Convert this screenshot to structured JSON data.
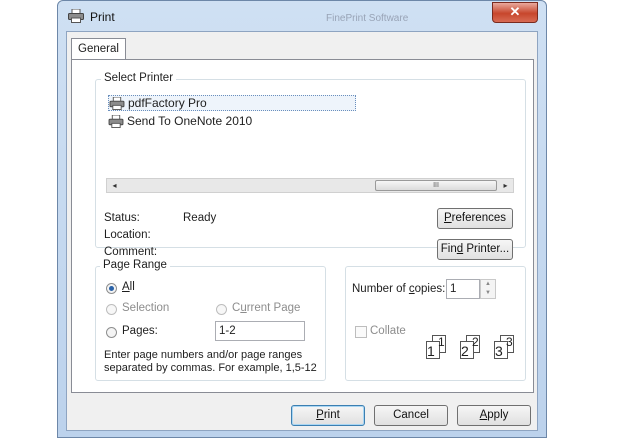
{
  "window": {
    "title": "Print",
    "background_title": "FinePrint Software",
    "close_symbol": "✕"
  },
  "tabs": [
    {
      "label": "General",
      "selected": true
    }
  ],
  "select_printer": {
    "legend": "Select Printer",
    "printers": [
      {
        "label": "pdfFactory Pro",
        "selected": true
      },
      {
        "label": "Send To OneNote 2010",
        "selected": false
      }
    ],
    "scroll_left": "◂",
    "scroll_right": "▸",
    "thumb_grip": "III",
    "status_label": "Status:",
    "status_value": "Ready",
    "location_label": "Location:",
    "comment_label": "Comment:",
    "preferences_button": {
      "pre": "",
      "key": "P",
      "post": "references"
    },
    "find_printer_button": {
      "pre": "Fin",
      "key": "d",
      "post": " Printer..."
    }
  },
  "page_range": {
    "legend": "Page Range",
    "all_label": {
      "pre": "",
      "key": "A",
      "post": "ll"
    },
    "selection_label": "Selection",
    "current_page_label": {
      "pre": "C",
      "key": "u",
      "post": "rrent Page"
    },
    "pages_label": {
      "pre": "Pa",
      "key": "g",
      "post": "es:"
    },
    "pages_value": "1-2",
    "hint_line1": "Enter page numbers and/or page ranges",
    "hint_line2": "separated by commas.  For example, 1,5-12",
    "selected": "all"
  },
  "copies": {
    "number_label": {
      "pre": "Number of ",
      "key": "c",
      "post": "opies:"
    },
    "value": "1",
    "collate_label": "Collate",
    "collate_checked": false,
    "collate_sets": [
      [
        "1",
        "1"
      ],
      [
        "2",
        "2"
      ],
      [
        "3",
        "3"
      ]
    ]
  },
  "footer": {
    "print_button": {
      "pre": "",
      "key": "P",
      "post": "rint"
    },
    "cancel_button": "Cancel",
    "apply_button": {
      "pre": "",
      "key": "A",
      "post": "pply"
    }
  },
  "colors": {
    "accent": "#3c7fb1",
    "close": "#c7462c",
    "frame": "#bcd2ec"
  }
}
